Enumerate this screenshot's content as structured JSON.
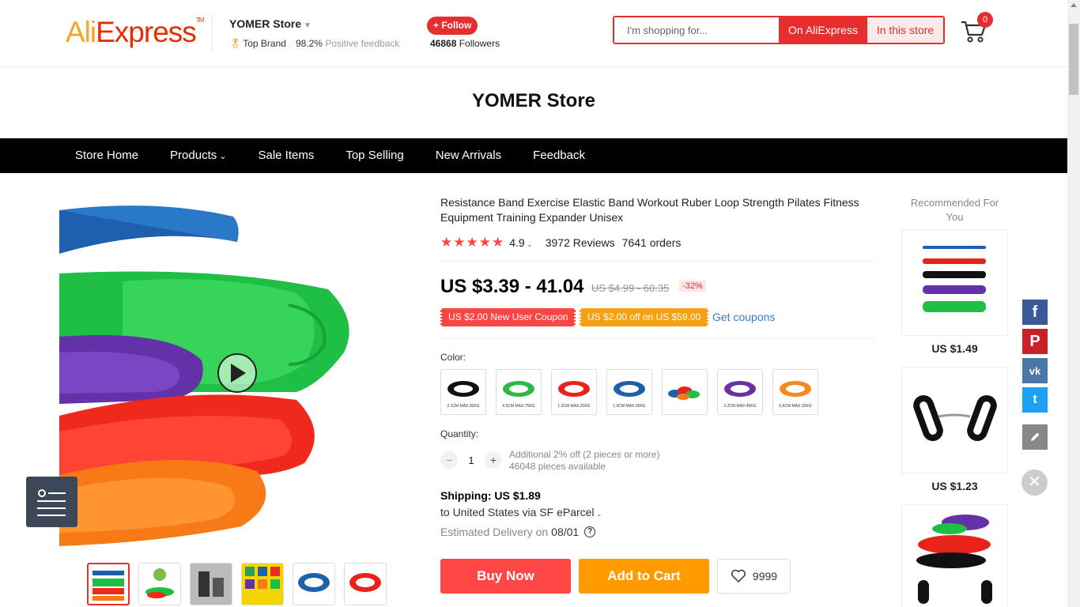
{
  "header": {
    "logo_part1": "Ali",
    "logo_part2": "Express",
    "logo_tm": "TM",
    "store_name": "YOMER Store",
    "badge": "Top Brand",
    "feedback_pct": "98.2%",
    "feedback_label": "Positive feedback",
    "follow_label": "+ Follow",
    "followers_count": "46868",
    "followers_label": "Followers",
    "search_placeholder": "I'm shopping for...",
    "search_on_ali": "On AliExpress",
    "search_in_store": "In this store",
    "cart_count": "0"
  },
  "store_title": "YOMER Store",
  "nav": {
    "items": [
      "Store Home",
      "Products",
      "Sale Items",
      "Top Selling",
      "New Arrivals",
      "Feedback"
    ]
  },
  "product": {
    "title": "Resistance Band Exercise Elastic Band Workout Ruber Loop Strength Pilates Fitness Equipment Training Expander Unisex",
    "rating": "4.9",
    "reviews": "3972 Reviews",
    "orders": "7641 orders",
    "price": "US $3.39 - 41.04",
    "old_price": "US $4.99 - 60.35",
    "discount": "-32%",
    "coupon_new_user": "US $2.00 New User Coupon",
    "coupon_off": "US $2.00 off on US $59.00",
    "get_coupons": "Get coupons",
    "color_label": "Color:",
    "quantity_label": "Quantity:",
    "quantity_value": "1",
    "qty_note1": "Additional 2% off (2 pieces or more)",
    "qty_note2": "46048 pieces available",
    "shipping": "Shipping: US $1.89",
    "shipping_to": "to United States via SF eParcel",
    "delivery_label": "Estimated Delivery on",
    "delivery_date": "08/01",
    "buy_now": "Buy Now",
    "add_to_cart": "Add to Cart",
    "wishlist_count": "9999"
  },
  "swatches": [
    {
      "color": "#111111",
      "label": "2.1CM MAX:30KG"
    },
    {
      "color": "#2fb84a",
      "label": "4.5CM MAX:75KG"
    },
    {
      "color": "#e8231c",
      "label": "1.3CM MAX:20KG"
    },
    {
      "color": "#1f5fa8",
      "label": "1.9CM MAX:26KG"
    },
    {
      "color": "#e8231c",
      "label": ""
    },
    {
      "color": "#6a2fa0",
      "label": "3.2CM MAX:45KG"
    },
    {
      "color": "#f7891f",
      "label": "0.6CM MAX:10KG"
    }
  ],
  "recommended": {
    "title": "Recommended For You",
    "prices": [
      "US $1.49",
      "US $1.23"
    ]
  },
  "colors": {
    "accent": "#e62e2e",
    "buy": "#ff4747",
    "cart": "#ff9a00",
    "facebook": "#3b5998",
    "pinterest": "#cb2027",
    "vk": "#4a76a8",
    "twitter": "#1da1f2",
    "edit": "#888888"
  }
}
